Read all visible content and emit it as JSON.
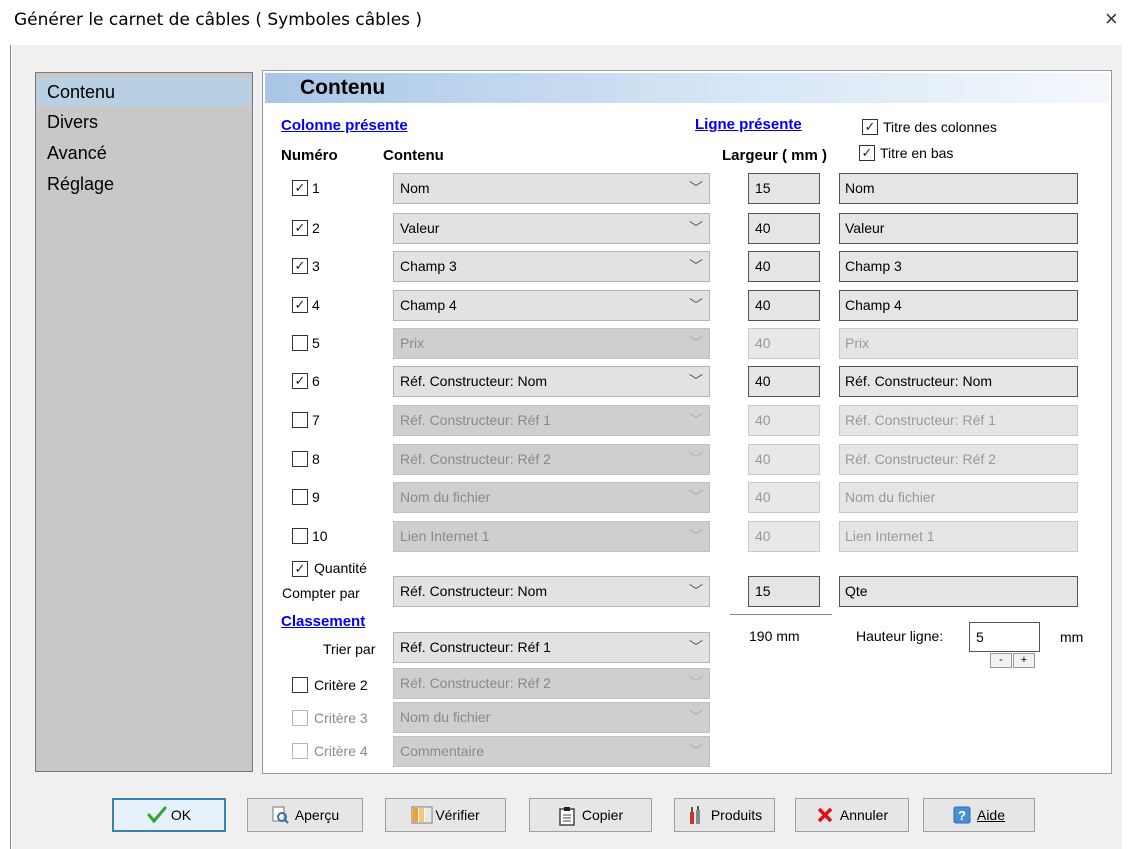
{
  "window": {
    "title": "Générer le carnet de câbles ( Symboles câbles )",
    "close_glyph": "×"
  },
  "nav": {
    "items": [
      "Contenu",
      "Divers",
      "Avancé",
      "Réglage"
    ],
    "active": "Contenu"
  },
  "content": {
    "title": "Contenu",
    "colonne_presente": "Colonne présente",
    "ligne_presente": "Ligne présente",
    "numero_header": "Numéro",
    "contenu_header": "Contenu",
    "largeur_header": "Largeur ( mm )",
    "titre_colonnes": {
      "label": "Titre des colonnes",
      "checked": true
    },
    "titre_en_bas": {
      "label": "Titre en bas",
      "checked": true
    },
    "rows": [
      {
        "num": "1",
        "checked": true,
        "content": "Nom",
        "width": "15",
        "title": "Nom"
      },
      {
        "num": "2",
        "checked": true,
        "content": "Valeur",
        "width": "40",
        "title": "Valeur"
      },
      {
        "num": "3",
        "checked": true,
        "content": "Champ 3",
        "width": "40",
        "title": "Champ 3"
      },
      {
        "num": "4",
        "checked": true,
        "content": "Champ 4",
        "width": "40",
        "title": "Champ 4"
      },
      {
        "num": "5",
        "checked": false,
        "content": "Prix",
        "width": "40",
        "title": "Prix"
      },
      {
        "num": "6",
        "checked": true,
        "content": "Réf. Constructeur: Nom",
        "width": "40",
        "title": "Réf. Constructeur: Nom"
      },
      {
        "num": "7",
        "checked": false,
        "content": "Réf. Constructeur: Réf 1",
        "width": "40",
        "title": "Réf. Constructeur: Réf 1"
      },
      {
        "num": "8",
        "checked": false,
        "content": "Réf. Constructeur: Réf 2",
        "width": "40",
        "title": "Réf. Constructeur: Réf 2"
      },
      {
        "num": "9",
        "checked": false,
        "content": "Nom du fichier",
        "width": "40",
        "title": "Nom du fichier"
      },
      {
        "num": "10",
        "checked": false,
        "content": "Lien Internet 1",
        "width": "40",
        "title": "Lien Internet 1"
      }
    ],
    "quantite": {
      "label": "Quantité",
      "checked": true
    },
    "compter_par": {
      "label": "Compter par",
      "value": "Réf. Constructeur: Nom",
      "width": "15",
      "title": "Qte"
    },
    "total_width": "190 mm",
    "hauteur_ligne": {
      "label": "Hauteur ligne:",
      "value": "5",
      "unit": "mm",
      "minus": "-",
      "plus": "+"
    },
    "classement": "Classement",
    "trier_par": {
      "label": "Trier par",
      "value": "Réf. Constructeur: Réf 1"
    },
    "criteres": [
      {
        "label": "Critère 2",
        "value": "Réf. Constructeur: Réf 2",
        "enabled_checkbox": true
      },
      {
        "label": "Critère 3",
        "value": "Nom du fichier",
        "enabled_checkbox": false
      },
      {
        "label": "Critère 4",
        "value": "Commentaire",
        "enabled_checkbox": false
      }
    ]
  },
  "buttons": [
    {
      "label": "OK",
      "icon": "checkmark-icon"
    },
    {
      "label": "Aperçu",
      "icon": "preview-icon"
    },
    {
      "label": "Vérifier",
      "icon": "verify-icon"
    },
    {
      "label": "Copier",
      "icon": "clipboard-icon"
    },
    {
      "label": "Produits",
      "icon": "products-icon"
    },
    {
      "label": "Annuler",
      "icon": "cancel-x-icon"
    },
    {
      "label": "Aide",
      "icon": "help-icon"
    }
  ],
  "colors": {
    "accent": "#3c7fb1",
    "link": "#0000ee",
    "nav_active": "#b8cfe4",
    "cancel_red": "#e01010",
    "ok_green": "#2fa52f"
  }
}
